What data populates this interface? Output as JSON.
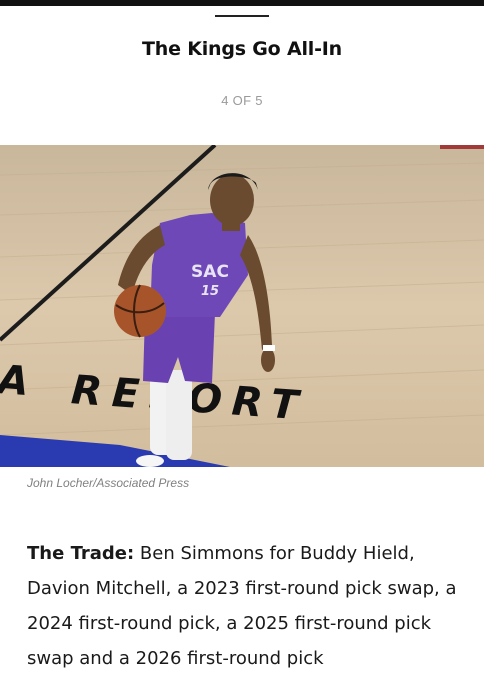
{
  "article": {
    "title": "The Kings Go All-In",
    "pager": "4 OF 5"
  },
  "photo": {
    "court_text": "RESORT",
    "jersey_text": "SAC",
    "jersey_number": "15",
    "credit": "John Locher/Associated Press"
  },
  "body": {
    "lead_label": "The Trade:",
    "text": " Ben Simmons for Buddy Hield, Davion Mitchell, a 2023 first-round pick swap, a 2024 first-round pick, a 2025 first-round pick swap and a 2026 first-round pick"
  },
  "colors": {
    "jersey": "#6f48b8",
    "court_blue": "#2a3ab0",
    "court_wood": "#d6c2a4"
  }
}
